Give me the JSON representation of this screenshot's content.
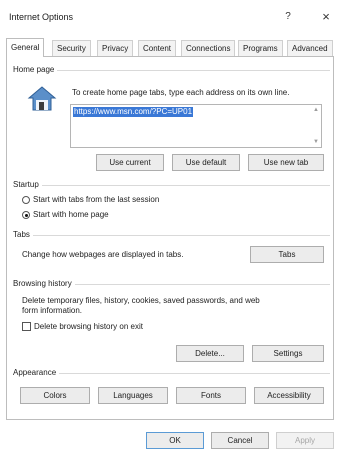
{
  "window": {
    "title": "Internet Options",
    "help_glyph": "?",
    "close_glyph": "×"
  },
  "tabs": [
    {
      "label": "General",
      "active": true
    },
    {
      "label": "Security",
      "active": false
    },
    {
      "label": "Privacy",
      "active": false
    },
    {
      "label": "Content",
      "active": false
    },
    {
      "label": "Connections",
      "active": false
    },
    {
      "label": "Programs",
      "active": false
    },
    {
      "label": "Advanced",
      "active": false
    }
  ],
  "home_page": {
    "group_label": "Home page",
    "description": "To create home page tabs, type each address on its own line.",
    "url_value": "https://www.msn.com/?PC=UP01",
    "use_current": "Use current",
    "use_default": "Use default",
    "use_new_tab": "Use new tab"
  },
  "startup": {
    "group_label": "Startup",
    "option_last_session": "Start with tabs from the last session",
    "option_home_page": "Start with home page",
    "selected": "home_page"
  },
  "tabs_section": {
    "group_label": "Tabs",
    "description": "Change how webpages are displayed in tabs.",
    "button": "Tabs"
  },
  "browsing_history": {
    "group_label": "Browsing history",
    "description_line1": "Delete temporary files, history, cookies, saved passwords, and web",
    "description_line2": "form information.",
    "delete_on_exit_label": "Delete browsing history on exit",
    "delete_on_exit_checked": false,
    "delete_button": "Delete...",
    "settings_button": "Settings"
  },
  "appearance": {
    "group_label": "Appearance",
    "colors": "Colors",
    "languages": "Languages",
    "fonts": "Fonts",
    "accessibility": "Accessibility"
  },
  "footer": {
    "ok": "OK",
    "cancel": "Cancel",
    "apply": "Apply"
  },
  "colors": {
    "selection_blue": "#3a78d6",
    "default_button_border": "#5b9bd5"
  }
}
